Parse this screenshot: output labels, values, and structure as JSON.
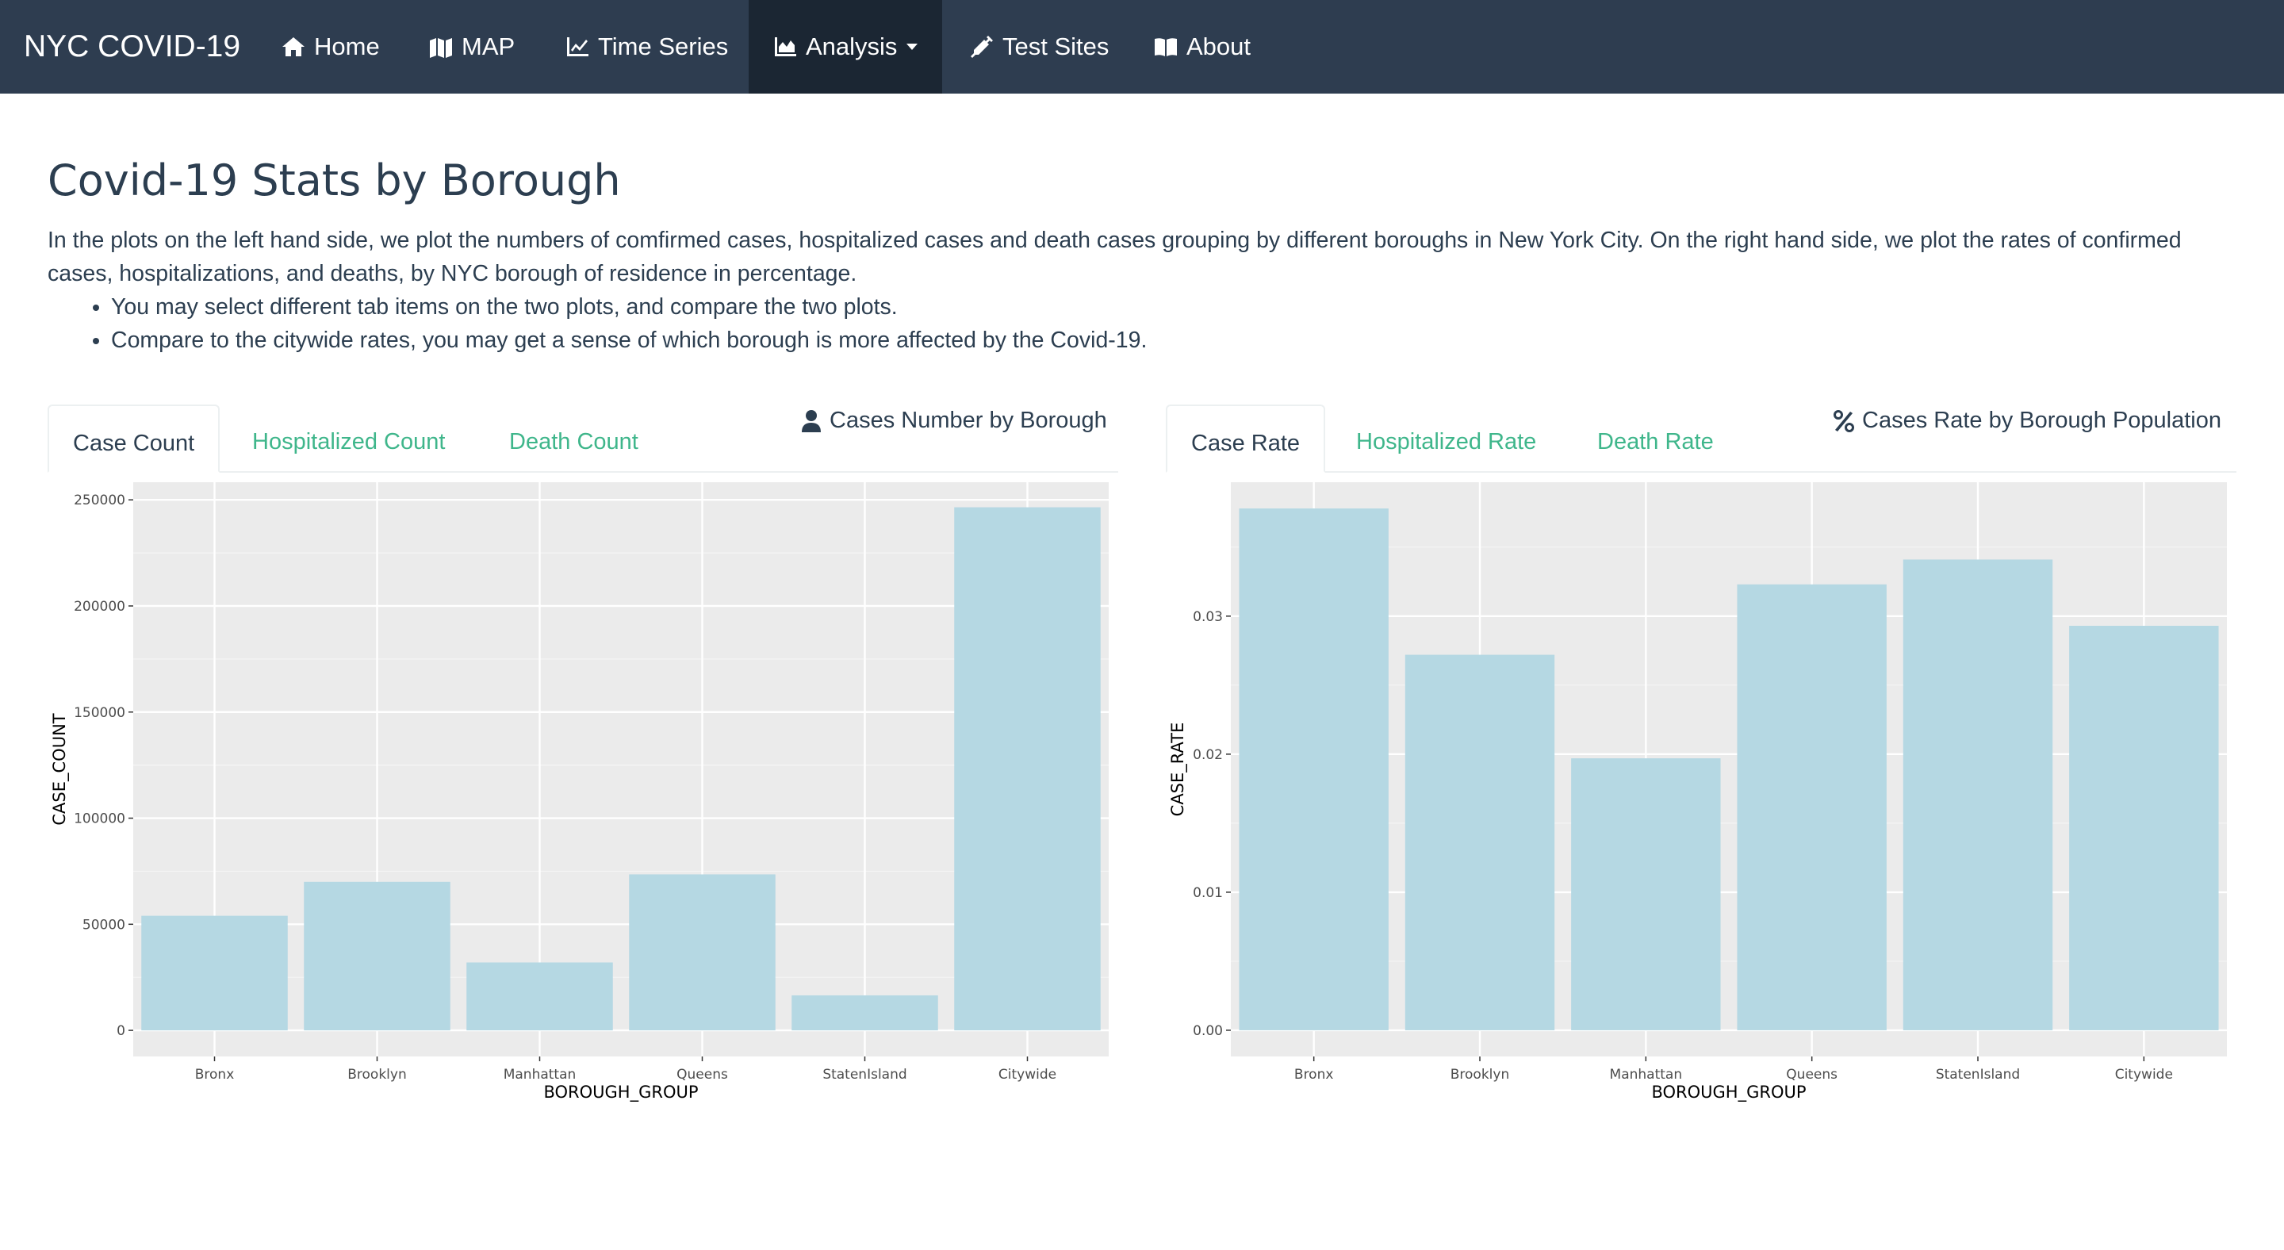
{
  "navbar": {
    "brand": "NYC COVID-19",
    "items": [
      {
        "label": "Home",
        "icon": "home-icon"
      },
      {
        "label": "MAP",
        "icon": "map-icon"
      },
      {
        "label": "Time Series",
        "icon": "line-chart-icon"
      },
      {
        "label": "Analysis",
        "icon": "area-chart-icon",
        "active": true,
        "dropdown": true
      },
      {
        "label": "Test Sites",
        "icon": "syringe-icon"
      },
      {
        "label": "About",
        "icon": "book-icon"
      }
    ]
  },
  "page": {
    "title": "Covid-19 Stats by Borough",
    "intro": "In the plots on the left hand side, we plot the numbers of comfirmed cases, hospitalized cases and death cases grouping by different boroughs in New York City. On the right hand side, we plot the rates of confirmed cases, hospitalizations, and deaths, by NYC borough of residence in percentage.",
    "bullets": [
      "You may select different tab items on the two plots, and compare the two plots.",
      "Compare to the citywide rates, you may get a sense of which borough is more affected by the Covid-19."
    ]
  },
  "left_panel": {
    "tabs": [
      "Case Count",
      "Hospitalized Count",
      "Death Count"
    ],
    "active_tab": 0,
    "title": "Cases Number by Borough",
    "title_icon": "user-icon"
  },
  "right_panel": {
    "tabs": [
      "Case Rate",
      "Hospitalized Rate",
      "Death Rate"
    ],
    "active_tab": 0,
    "title": "Cases Rate by Borough Population",
    "title_icon": "percent-icon"
  },
  "colors": {
    "navbar": "#2e3d50",
    "navbar_active": "#1b2633",
    "bar_fill": "#b5d8e3",
    "panel_bg": "#ebebeb",
    "tab_link": "#3fb68b"
  },
  "chart_data": [
    {
      "type": "bar",
      "categories": [
        "Bronx",
        "Brooklyn",
        "Manhattan",
        "Queens",
        "StatenIsland",
        "Citywide"
      ],
      "values": [
        54000,
        70000,
        32000,
        73500,
        16500,
        246500
      ],
      "xlabel": "BOROUGH_GROUP",
      "ylabel": "CASE_COUNT",
      "yticks": [
        "0",
        "50000",
        "100000",
        "150000",
        "200000",
        "250000"
      ],
      "ylim": [
        -12300,
        258300
      ],
      "grid": true
    },
    {
      "type": "bar",
      "categories": [
        "Bronx",
        "Brooklyn",
        "Manhattan",
        "Queens",
        "StatenIsland",
        "Citywide"
      ],
      "values": [
        0.0378,
        0.0272,
        0.0197,
        0.0323,
        0.0341,
        0.0293
      ],
      "xlabel": "BOROUGH_GROUP",
      "ylabel": "CASE_RATE",
      "yticks": [
        "0.00",
        "0.01",
        "0.02",
        "0.03"
      ],
      "ylim": [
        -0.0019,
        0.0397
      ],
      "grid": true
    }
  ]
}
